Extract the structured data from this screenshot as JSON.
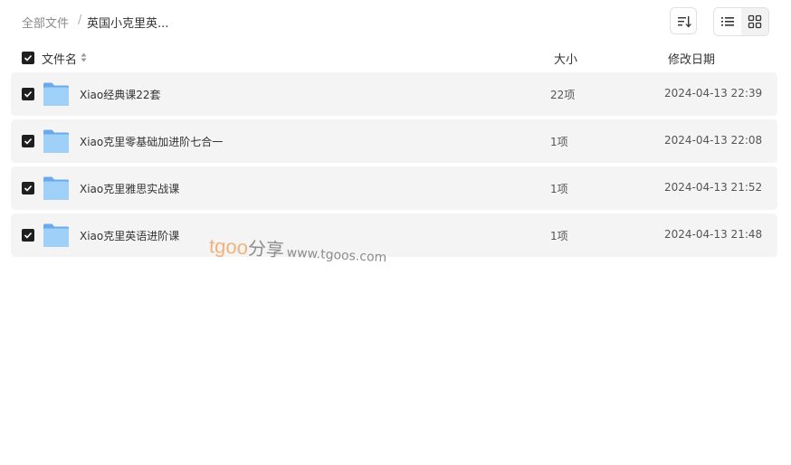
{
  "breadcrumb": {
    "root": "全部文件",
    "separator": "/",
    "current": "英国小克里英..."
  },
  "columns": {
    "name": "文件名",
    "size": "大小",
    "modified": "修改日期"
  },
  "files": [
    {
      "name": "Xiao经典课22套",
      "size": "22项",
      "modified": "2024-04-13 22:39",
      "checked": true
    },
    {
      "name": "Xiao克里零基础加进阶七合一",
      "size": "1项",
      "modified": "2024-04-13 22:08",
      "checked": true
    },
    {
      "name": "Xiao克里雅思实战课",
      "size": "1项",
      "modified": "2024-04-13 21:52",
      "checked": true
    },
    {
      "name": "Xiao克里英语进阶课",
      "size": "1项",
      "modified": "2024-04-13 21:48",
      "checked": true
    }
  ],
  "watermark": {
    "brand": "tgoo",
    "suffix": "分享",
    "url": "www.tgoos.com"
  },
  "icons": {
    "sort": "sort-icon",
    "list_view": "list-view-icon",
    "grid_view": "grid-view-icon",
    "folder": "folder-icon",
    "checkbox": "checkbox-checked-icon"
  },
  "colors": {
    "row_bg": "#f4f4f4",
    "checkbox": "#1f1f1f",
    "folder": "#7db9ef",
    "watermark_brand": "#f2b27a"
  }
}
